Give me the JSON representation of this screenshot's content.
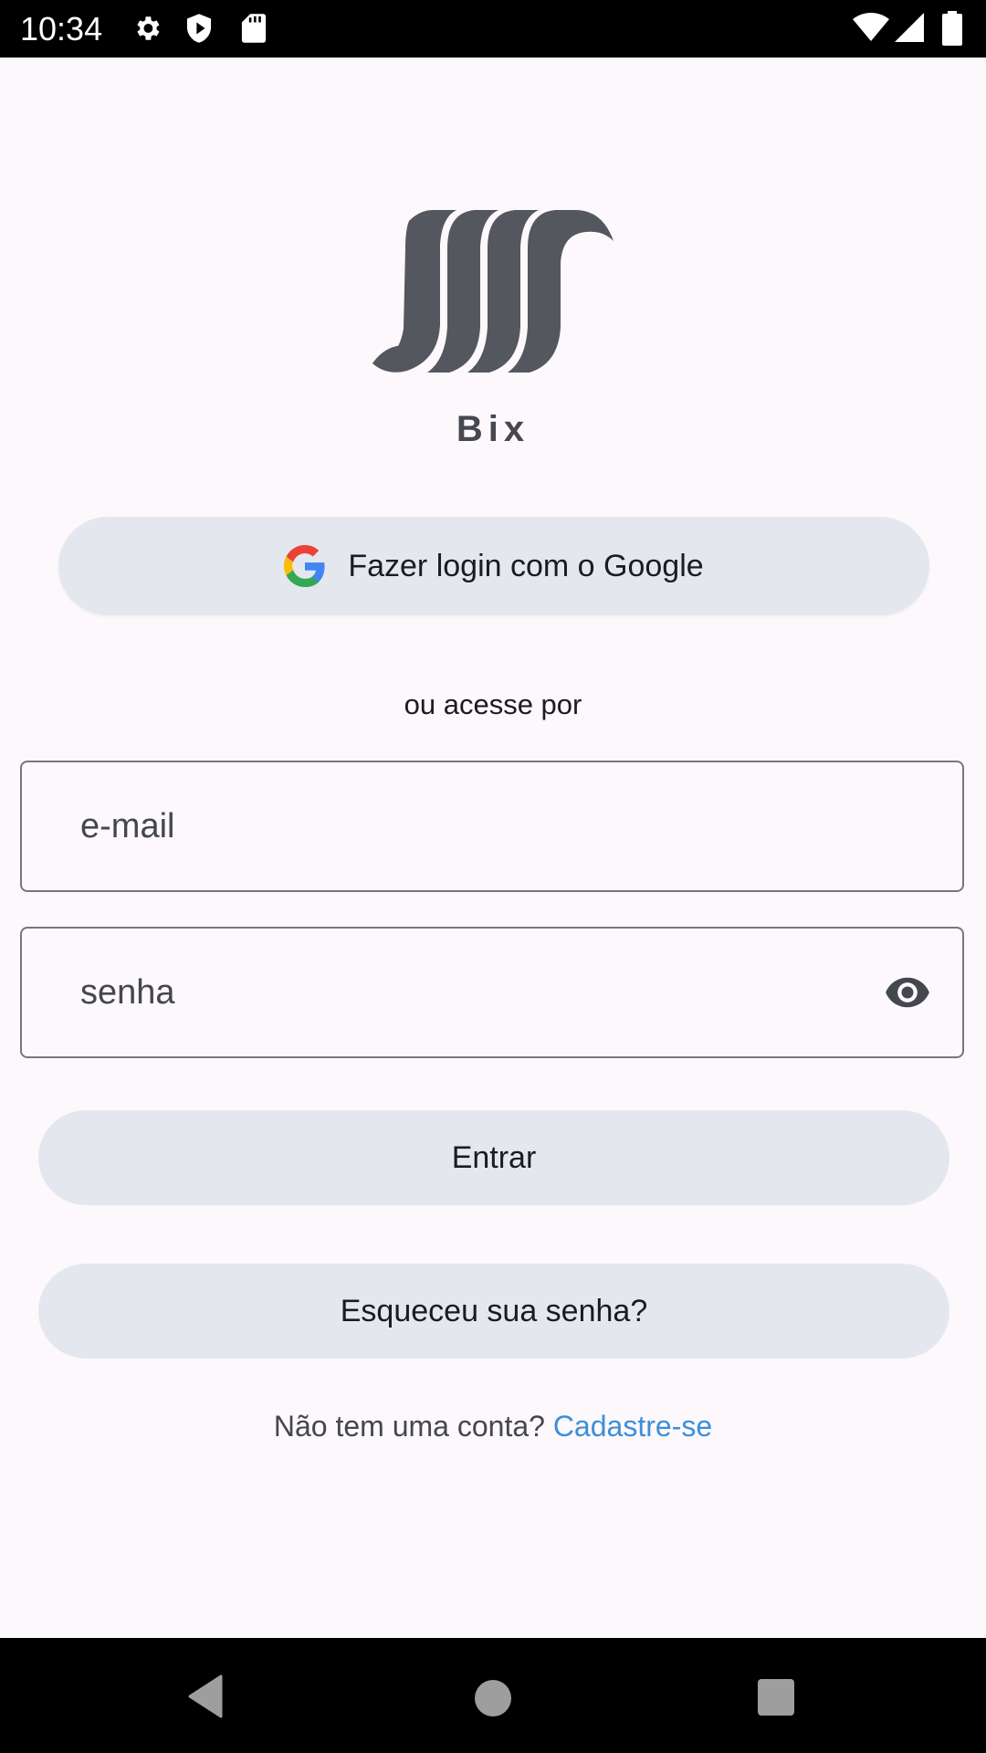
{
  "status_bar": {
    "time": "10:34",
    "left_icons": [
      "gear-icon",
      "shield-icon",
      "sd-card-icon"
    ],
    "right_icons": [
      "wifi-icon",
      "signal-icon",
      "battery-icon"
    ]
  },
  "app": {
    "name": "Bix",
    "logo": "bix-logo"
  },
  "google_button": {
    "label": "Fazer login com o Google",
    "icon": "google-icon"
  },
  "divider_text": "ou acesse por",
  "email_field": {
    "placeholder": "e-mail",
    "value": ""
  },
  "password_field": {
    "placeholder": "senha",
    "value": "",
    "toggle_icon": "eye-icon"
  },
  "login_button": {
    "label": "Entrar"
  },
  "forgot_button": {
    "label": "Esqueceu sua senha?"
  },
  "signup": {
    "prompt": "Não tem uma conta?",
    "link": "Cadastre-se"
  },
  "nav_bar": {
    "items": [
      "back-icon",
      "home-icon",
      "recents-icon"
    ]
  },
  "colors": {
    "background": "#fcf8fc",
    "button_bg": "#e4e8ee",
    "link": "#3d8fd8",
    "logo": "#55575e",
    "outline": "#75777f"
  }
}
